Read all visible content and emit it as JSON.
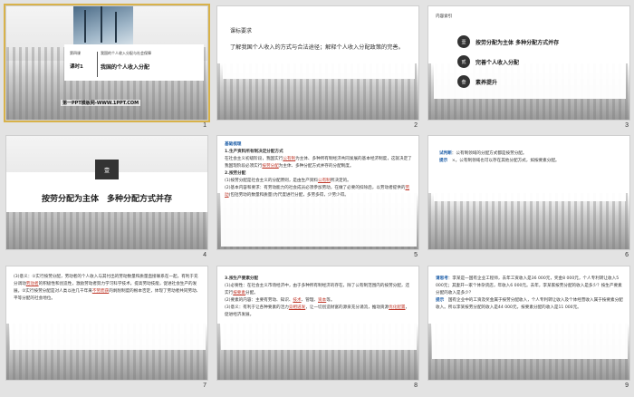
{
  "slides": [
    {
      "num": "1",
      "series": "第四课",
      "lesson": "课时1",
      "subtitle": "我国的个人收入分配与社会保障",
      "title": "我国的个人收入分配",
      "logo": "第一PPT模板网-WWW.1PPT.COM"
    },
    {
      "num": "2",
      "label": "课标要求",
      "text": "了解我国个人收入的方式与合法途径；解释个人收入分配政策的完善。"
    },
    {
      "num": "3",
      "head": "内容索引",
      "items": [
        {
          "badge": "壹",
          "label": "按劳分配为主体 多种分配方式并存"
        },
        {
          "badge": "贰",
          "label": "完善个人收入分配"
        },
        {
          "badge": "叁",
          "label": "素养提升"
        }
      ]
    },
    {
      "num": "4",
      "badge": "壹",
      "title": "按劳分配为主体　多种分配方式并存"
    },
    {
      "num": "5",
      "section": "基础梳理",
      "h1": "1.生产资料所有制决定分配方式",
      "p1a": "在社会主义初级阶段，我国实行",
      "p1r1": "公有制",
      "p1b": "为主体、多种所有制经济共同发展的基本经济制度，这就决定了我国现阶段必须实行",
      "p1r2": "按劳分配",
      "p1c": "为主体、多种分配方式并存的分配制度。",
      "h2": "2.按劳分配",
      "p2a": "(1)按劳分配是社会主义的分配原则，是由生产资料",
      "p2r": "公有制",
      "p2b": "所决定的。",
      "p3": "(2)基本内容和要求：有劳动能力的社会成员必须参加劳动，在做了必要的扣除后，以劳动者提供的",
      "p3r": "劳动",
      "p3b": "(包括劳动的数量和质量)为尺度进行分配，多劳多得，少劳少得。"
    },
    {
      "num": "6",
      "k": "试判断",
      "q": "：公有制领域的分配方式都是按劳分配。",
      "k2": "提示",
      "a": "×。公有制领域也可以存在其他分配方式，如按要素分配。"
    },
    {
      "num": "7",
      "t1": "(3)意义：①实行按劳分配，劳动者的个人收入与其付出的劳动数量和质量直接联系在一起，有利于充分调动",
      "r1": "劳动者",
      "t2": "的积极性和创造性，激励劳动者努力学习科学技术，提高劳动技能，促进社会生产的发展。②实行按劳分配是对人类以往几千年来",
      "r2": "不劳而获",
      "t3": "的剥削制度的根本否定，体现了劳动者共同劳动、平等分配的社会地位。"
    },
    {
      "num": "8",
      "h": "3.按生产要素分配",
      "t1": "(1)必要性：在社会主义市场经济中，由于多种所有制经济的存在，除了公有制范围内的按劳分配，还实行",
      "r1": "按要素",
      "t2": "分配。",
      "t3": "(2)要素的内容：主要有劳动、知识、",
      "r2": "技术",
      "t4": "、管理、",
      "r3": "资本",
      "t5": "等。",
      "t6": "(3)意义：有利于让各种要素的活力",
      "r4": "竞相迸发",
      "t7": "，让一切创造财富的源泉充分涌流，推动资源",
      "r5": "优化配置",
      "t8": "，促进经济发展。"
    },
    {
      "num": "9",
      "k": "请思考",
      "q": "：李某是一国有企业工程师，去年工资收入是36 000元，奖金8 000元，个人专利转让收入5 000元；其妻开一家个体杂货店，年收入6 000元。去年，李某家按劳分配的收入是多少？按生产要素分配的收入是多少？",
      "k2": "提示",
      "a": "国有企业中的工资及奖金属于按劳分配收入，个人专利转让收入及个体经营收入属于按要素分配收入。所以李某按劳分配的收入是44 000元，按要素分配的收入是11 000元。"
    }
  ]
}
